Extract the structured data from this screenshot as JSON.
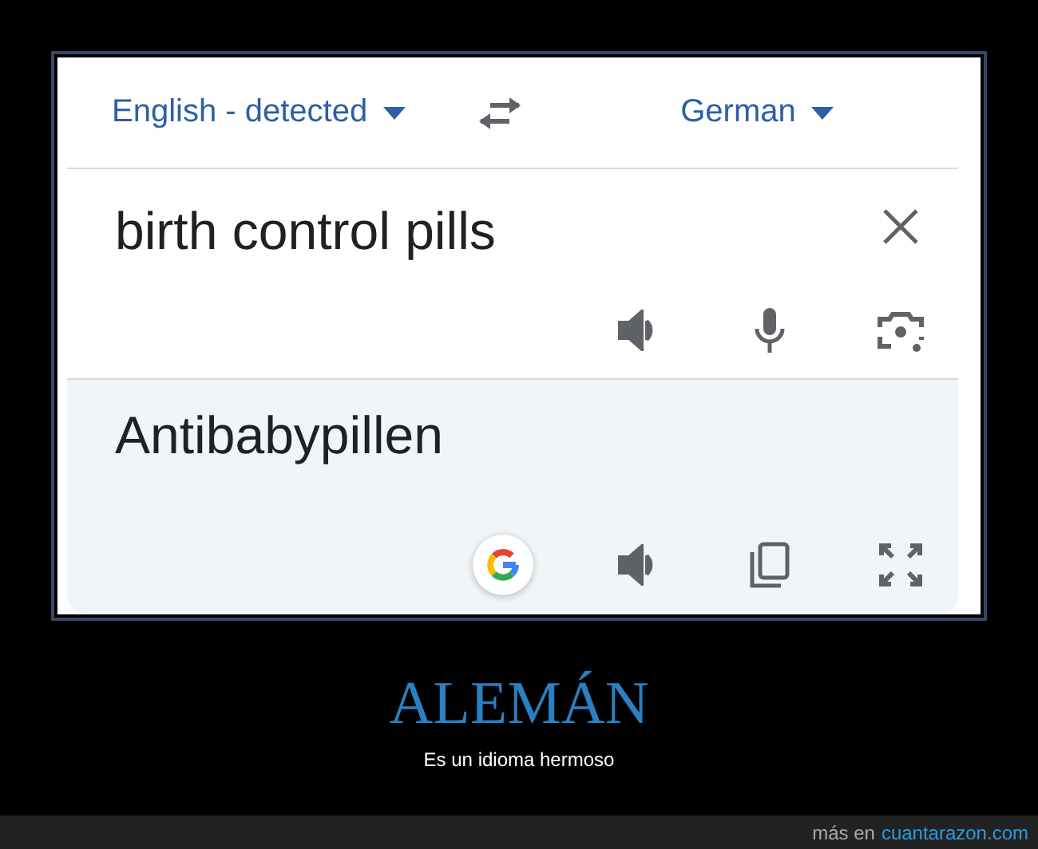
{
  "translator": {
    "source_language": "English - detected",
    "target_language": "German",
    "input_text": "birth control pills",
    "output_text": "Antibabypillen"
  },
  "caption": {
    "title": "ALEMÁN",
    "subtitle": "Es un idioma hermoso"
  },
  "footer": {
    "prefix": "más en",
    "link": "cuantarazon.com"
  }
}
